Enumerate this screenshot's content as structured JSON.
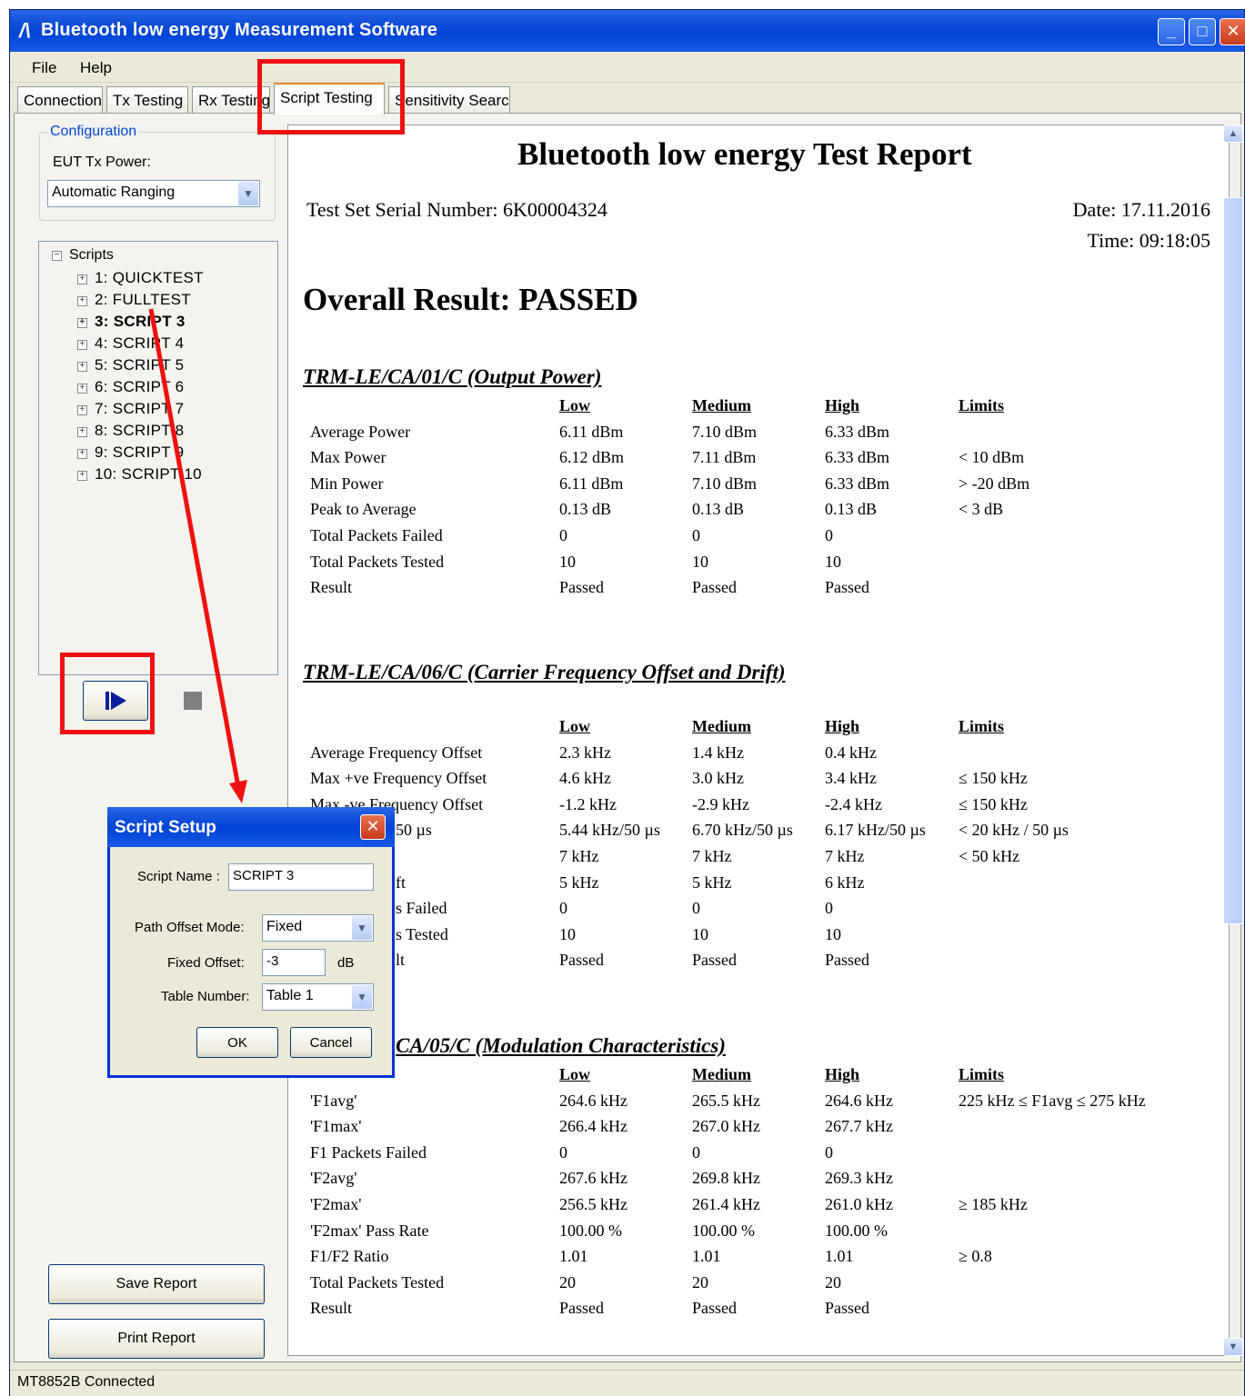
{
  "window": {
    "title": "Bluetooth low energy Measurement Software",
    "icon": "app-logo-icon"
  },
  "menu": {
    "items": [
      "File",
      "Help"
    ]
  },
  "tabs": {
    "items": [
      "Connection",
      "Tx Testing",
      "Rx Testing",
      "Script Testing",
      "Sensitivity Search"
    ],
    "active": "Script Testing"
  },
  "config": {
    "legend": "Configuration",
    "eut_label": "EUT Tx Power:",
    "eut_value": "Automatic Ranging"
  },
  "scripts": {
    "root": "Scripts",
    "items": [
      "1: QUICKTEST",
      "2: FULLTEST",
      "3: SCRIPT  3",
      "4: SCRIPT  4",
      "5: SCRIPT  5",
      "6: SCRIPT  6",
      "7: SCRIPT  7",
      "8: SCRIPT  8",
      "9: SCRIPT  9",
      "10: SCRIPT 10"
    ],
    "selected_index": 2
  },
  "buttons": {
    "save": "Save Report",
    "print": "Print Report",
    "run_icon": "play-icon",
    "stop_icon": "stop-icon"
  },
  "status": "MT8852B Connected",
  "report": {
    "title": "Bluetooth low energy Test Report",
    "serial": "Test Set Serial Number: 6K00004324",
    "date": "Date: 17.11.2016",
    "time": "Time: 09:18:05",
    "overall": "Overall Result: PASSED",
    "columns": [
      "Low",
      "Medium",
      "High",
      "Limits"
    ],
    "sections": [
      {
        "title": "TRM-LE/CA/01/C (Output Power)",
        "rows": [
          [
            "Average Power",
            "6.11 dBm",
            "7.10 dBm",
            "6.33 dBm",
            ""
          ],
          [
            "Max Power",
            "6.12 dBm",
            "7.11 dBm",
            "6.33 dBm",
            "< 10 dBm"
          ],
          [
            "Min Power",
            "6.11 dBm",
            "7.10 dBm",
            "6.33 dBm",
            "> -20 dBm"
          ],
          [
            "Peak to Average",
            "0.13 dB",
            "0.13 dB",
            "0.13 dB",
            "< 3 dB"
          ],
          [
            "Total Packets Failed",
            "0",
            "0",
            "0",
            ""
          ],
          [
            "Total Packets Tested",
            "10",
            "10",
            "10",
            ""
          ],
          [
            "Result",
            "Passed",
            "Passed",
            "Passed",
            ""
          ]
        ]
      },
      {
        "title": "TRM-LE/CA/06/C (Carrier Frequency Offset and Drift)",
        "rows": [
          [
            "Average Frequency Offset",
            "2.3 kHz",
            "1.4 kHz",
            "0.4 kHz",
            ""
          ],
          [
            "Max +ve Frequency Offset",
            "4.6 kHz",
            "3.0 kHz",
            "3.4 kHz",
            "≤ 150 kHz"
          ],
          [
            "Max -ve Frequency Offset",
            "-1.2 kHz",
            "-2.9 kHz",
            "-2.4 kHz",
            "≤ 150 kHz"
          ],
          [
            "50 µs",
            "5.44 kHz/50 µs",
            "6.70 kHz/50 µs",
            "6.17 kHz/50 µs",
            "< 20 kHz / 50 µs"
          ],
          [
            "",
            "7 kHz",
            "7 kHz",
            "7 kHz",
            "< 50 kHz"
          ],
          [
            "ft",
            "5 kHz",
            "5 kHz",
            "6 kHz",
            ""
          ],
          [
            "s Failed",
            "0",
            "0",
            "0",
            ""
          ],
          [
            "s Tested",
            "10",
            "10",
            "10",
            ""
          ],
          [
            "lt",
            "Passed",
            "Passed",
            "Passed",
            ""
          ]
        ]
      },
      {
        "title": "CA/05/C (Modulation Characteristics)",
        "rows": [
          [
            "'F1avg'",
            "264.6 kHz",
            "265.5 kHz",
            "264.6 kHz",
            "225 kHz ≤ F1avg ≤ 275 kHz"
          ],
          [
            "'F1max'",
            "266.4 kHz",
            "267.0 kHz",
            "267.7 kHz",
            ""
          ],
          [
            "F1 Packets Failed",
            "0",
            "0",
            "0",
            ""
          ],
          [
            "'F2avg'",
            "267.6 kHz",
            "269.8 kHz",
            "269.3 kHz",
            ""
          ],
          [
            "'F2max'",
            "256.5 kHz",
            "261.4 kHz",
            "261.0 kHz",
            "≥ 185 kHz"
          ],
          [
            "'F2max' Pass Rate",
            "100.00 %",
            "100.00 %",
            "100.00 %",
            ""
          ],
          [
            "F1/F2 Ratio",
            "1.01",
            "1.01",
            "1.01",
            "≥ 0.8"
          ],
          [
            "Total Packets Tested",
            "20",
            "20",
            "20",
            ""
          ],
          [
            "Result",
            "Passed",
            "Passed",
            "Passed",
            ""
          ]
        ]
      }
    ]
  },
  "dialog": {
    "title": "Script Setup",
    "script_name_label": "Script Name :",
    "script_name_value": "SCRIPT  3",
    "path_offset_label": "Path Offset Mode:",
    "path_offset_value": "Fixed",
    "fixed_offset_label": "Fixed Offset:",
    "fixed_offset_value": "-3",
    "fixed_offset_unit": "dB",
    "table_number_label": "Table Number:",
    "table_number_value": "Table 1",
    "ok": "OK",
    "cancel": "Cancel"
  },
  "annotations": {
    "highlight_color": "#ee1111"
  }
}
